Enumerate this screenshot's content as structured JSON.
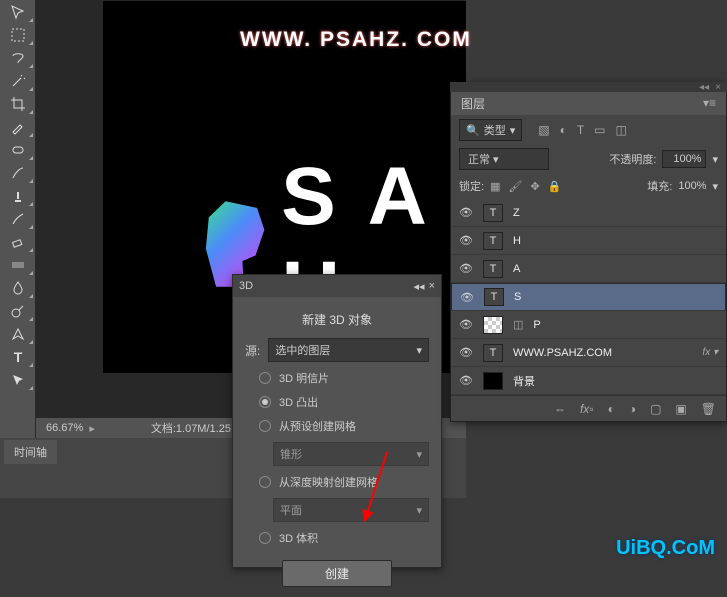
{
  "canvas": {
    "url_text": "WWW. PSAHZ. COM",
    "text_letters": "S A H"
  },
  "status": {
    "zoom": "66.67%",
    "doc": "文档:1.07M/1.25"
  },
  "timeline": {
    "tab": "时间轴"
  },
  "panel3d": {
    "tab": "3D",
    "title": "新建 3D 对象",
    "source_label": "源:",
    "source_value": "选中的图层",
    "opt_postcard": "3D 明信片",
    "opt_extrude": "3D 凸出",
    "opt_preset": "从预设创建网格",
    "preset_value": "锥形",
    "opt_depth": "从深度映射创建网格",
    "depth_value": "平面",
    "opt_volume": "3D 体积",
    "create_btn": "创建"
  },
  "layers": {
    "tab": "图层",
    "kind_label": "类型",
    "blend_mode": "正常",
    "opacity_label": "不透明度:",
    "opacity_value": "100%",
    "lock_label": "锁定:",
    "fill_label": "填充:",
    "fill_value": "100%",
    "items": [
      {
        "thumb": "T",
        "name": "Z"
      },
      {
        "thumb": "T",
        "name": "H"
      },
      {
        "thumb": "T",
        "name": "A"
      },
      {
        "thumb": "T",
        "name": "S",
        "selected": true
      },
      {
        "thumb": "chk",
        "name": "P"
      },
      {
        "thumb": "T",
        "name": "WWW.PSAHZ.COM",
        "fx": true
      },
      {
        "thumb": "blk",
        "name": "背景"
      }
    ]
  },
  "watermark": "UiBQ.CoM"
}
